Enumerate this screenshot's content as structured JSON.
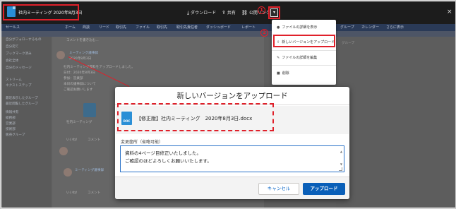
{
  "viewer": {
    "file_title": "社内ミーティング 2020年8月3日",
    "actions": [
      {
        "icon": "download-icon",
        "glyph": "⤓",
        "label": "ダウンロード"
      },
      {
        "icon": "share-icon",
        "glyph": "⇪",
        "label": "共有"
      },
      {
        "icon": "link-icon",
        "glyph": "⛓",
        "label": "公開リンク"
      }
    ],
    "menu_glyph": "▾",
    "close_glyph": "×"
  },
  "callouts": {
    "step1": "1",
    "step2": "2"
  },
  "app": {
    "nav_items": [
      "セールス",
      "ホーム",
      "商談",
      "リード",
      "取引先",
      "ファイル",
      "取引先",
      "取引先責任者",
      "ダッシュボード",
      "レポート",
      "グループ",
      "カレンダー",
      "さらに表示"
    ],
    "left_items": [
      "自分がフォローするもの",
      "自分宛て",
      "ブックマーク済み",
      "会社全体",
      "自分のメッセージ",
      "ストリーム",
      "ネクストステップ",
      "最近表示したグループ",
      "最近閲覧したグループ",
      "情報共有",
      "総務部",
      "営業部",
      "技術部",
      "販売グループ"
    ],
    "feed_lines": [
      "ミーティング議事録",
      "2020年8月3日",
      "社内ミーティング資料をアップロードしました。",
      "日付：2020年8月3日",
      "参加：営業部",
      "本日の議事録について",
      "ご確認お願いします"
    ],
    "feed_file": "社内ミーティング",
    "like_label": "いいね!",
    "comment_label": "コメント",
    "comment_placeholder": "コメントを書き込む..."
  },
  "dropdown": {
    "items": [
      {
        "icon": "info-icon",
        "glyph": "●",
        "label": "ファイルの詳細を表示"
      },
      {
        "icon": "upload-icon",
        "glyph": "⇧",
        "label": "新しいバージョンをアップロード"
      },
      {
        "icon": "edit-icon",
        "glyph": "✎",
        "label": "ファイルの詳細を編集"
      },
      {
        "icon": "delete-icon",
        "glyph": "■",
        "label": "削除"
      }
    ]
  },
  "modal": {
    "title": "新しいバージョンをアップロード",
    "file_icon_label": "DOC",
    "file_name": "【修正版】社内ミーティング　2020年8月3日.docx",
    "field_label": "変更箇所（省略可能）",
    "textarea_lines": [
      "資料の4ページ目修正いたしました。",
      "ご確認のほどよろしくお願いいたします。"
    ],
    "cancel_label": "キャンセル",
    "upload_label": "アップロード"
  },
  "colors": {
    "accent_red": "#e0202a",
    "brand_blue": "#0a5fb8",
    "file_blue": "#2a8fd6"
  }
}
